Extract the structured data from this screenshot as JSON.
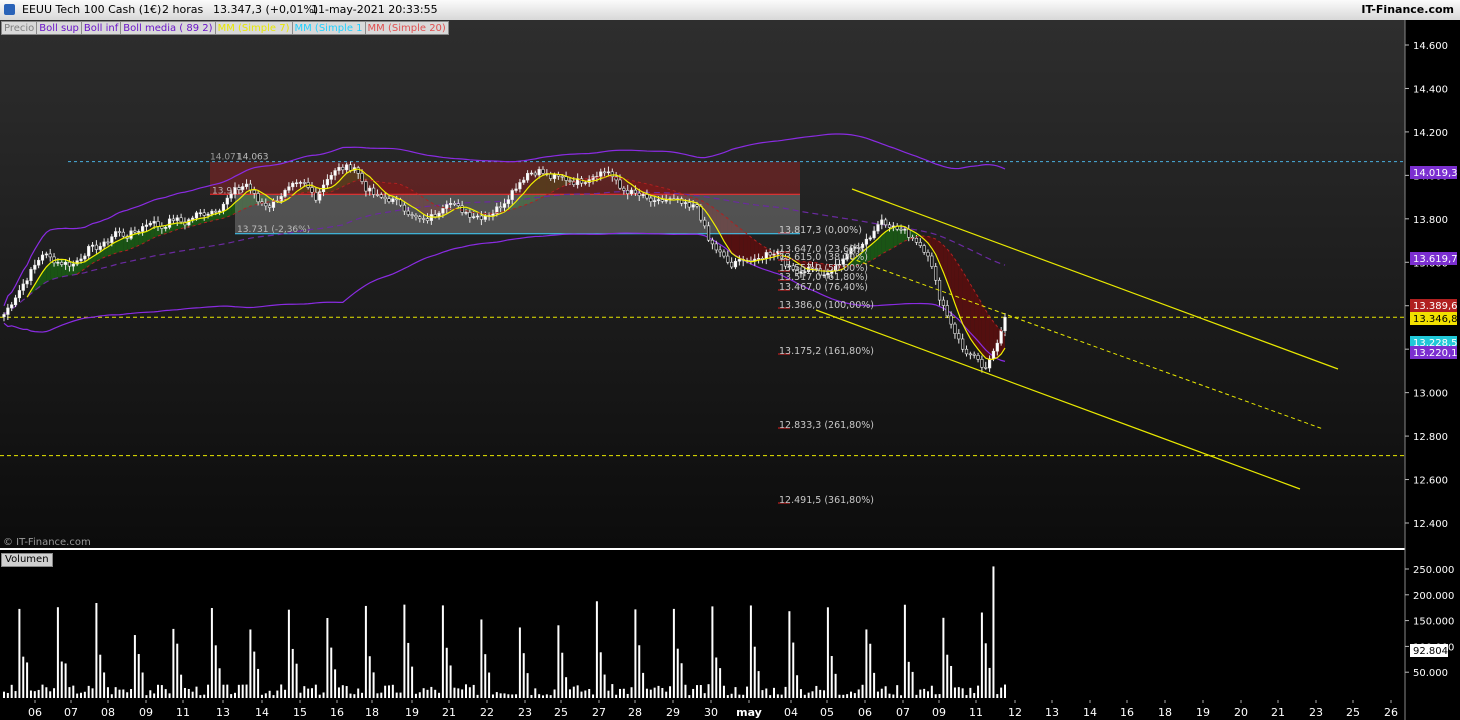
{
  "header": {
    "instrument": "EEUU Tech 100 Cash (1€)",
    "timeframe": "2 horas",
    "quote": "13.347,3 (+0,01%)",
    "datetime": "11-may-2021 20:33:55",
    "brand": "IT-Finance.com"
  },
  "legend": [
    {
      "label": "Precio",
      "color": "#808080"
    },
    {
      "label": "Boll sup",
      "color": "#6a14c8"
    },
    {
      "label": "Boll inf",
      "color": "#6a14c8"
    },
    {
      "label": "Boll media ( 89 2)",
      "color": "#6a14c8"
    },
    {
      "label": "MM (Simple 7)",
      "color": "#e8e800"
    },
    {
      "label": "MM (Simple 1",
      "color": "#20d0ff"
    },
    {
      "label": "MM (Simple 20)",
      "color": "#e05050"
    }
  ],
  "copyright": "© IT-Finance.com",
  "volume_label": "Volumen",
  "colors": {
    "up": "#ffffff",
    "down": "#ffffff",
    "boll": "#8a2be2",
    "ma_fast": "#f0f000",
    "ma_slow": "#d03030",
    "channel": "#e8e800",
    "level": "#e8e800",
    "range_box": "#7a1f1f"
  },
  "chart_data": [
    {
      "type": "candlestick",
      "title": "EEUU Tech 100 Cash (1€) 2 horas",
      "ylim": [
        12300,
        14750
      ],
      "y_ticks": [
        "14.600",
        "14.400",
        "14.200",
        "14.000",
        "13.800",
        "13.600",
        "13.400",
        "13.200",
        "13.000",
        "12.800",
        "12.600",
        "12.400"
      ],
      "x_ticks": [
        "06",
        "07",
        "08",
        "09",
        "11",
        "13",
        "14",
        "15",
        "16",
        "18",
        "19",
        "21",
        "22",
        "23",
        "25",
        "27",
        "28",
        "29",
        "30",
        "may",
        "04",
        "05",
        "06",
        "07",
        "09",
        "11",
        "12",
        "13",
        "14",
        "16",
        "18",
        "19",
        "20",
        "21",
        "23",
        "25",
        "26"
      ],
      "price_path": [
        [
          0,
          13360
        ],
        [
          5,
          13500
        ],
        [
          10,
          13640
        ],
        [
          14,
          13600
        ],
        [
          18,
          13590
        ],
        [
          22,
          13660
        ],
        [
          26,
          13680
        ],
        [
          29,
          13740
        ],
        [
          32,
          13720
        ],
        [
          35,
          13750
        ],
        [
          38,
          13790
        ],
        [
          41,
          13760
        ],
        [
          44,
          13800
        ],
        [
          47,
          13780
        ],
        [
          50,
          13820
        ],
        [
          53,
          13830
        ],
        [
          56,
          13850
        ],
        [
          60,
          13930
        ],
        [
          63,
          13960
        ],
        [
          66,
          13880
        ],
        [
          69,
          13860
        ],
        [
          72,
          13910
        ],
        [
          75,
          13950
        ],
        [
          78,
          13960
        ],
        [
          81,
          13900
        ],
        [
          84,
          13990
        ],
        [
          87,
          14030
        ],
        [
          91,
          14040
        ],
        [
          94,
          13940
        ],
        [
          97,
          13900
        ],
        [
          100,
          13890
        ],
        [
          103,
          13870
        ],
        [
          106,
          13810
        ],
        [
          109,
          13790
        ],
        [
          112,
          13820
        ],
        [
          115,
          13880
        ],
        [
          118,
          13850
        ],
        [
          121,
          13820
        ],
        [
          124,
          13810
        ],
        [
          127,
          13830
        ],
        [
          130,
          13880
        ],
        [
          133,
          13950
        ],
        [
          136,
          14010
        ],
        [
          139,
          14020
        ],
        [
          142,
          13990
        ],
        [
          145,
          13990
        ],
        [
          148,
          13970
        ],
        [
          151,
          13980
        ],
        [
          154,
          14010
        ],
        [
          157,
          14020
        ],
        [
          160,
          13940
        ],
        [
          163,
          13920
        ],
        [
          166,
          13900
        ],
        [
          169,
          13870
        ],
        [
          172,
          13890
        ],
        [
          175,
          13880
        ],
        [
          178,
          13850
        ],
        [
          180,
          13860
        ],
        [
          183,
          13700
        ],
        [
          186,
          13640
        ],
        [
          189,
          13580
        ],
        [
          192,
          13620
        ],
        [
          195,
          13600
        ],
        [
          198,
          13640
        ],
        [
          201,
          13650
        ],
        [
          204,
          13570
        ],
        [
          207,
          13560
        ],
        [
          210,
          13580
        ],
        [
          213,
          13530
        ],
        [
          216,
          13580
        ],
        [
          219,
          13640
        ],
        [
          222,
          13680
        ],
        [
          225,
          13720
        ],
        [
          228,
          13800
        ],
        [
          231,
          13760
        ],
        [
          234,
          13740
        ],
        [
          237,
          13700
        ],
        [
          240,
          13640
        ],
        [
          243,
          13440
        ],
        [
          246,
          13320
        ],
        [
          249,
          13200
        ],
        [
          252,
          13160
        ],
        [
          255,
          13100
        ],
        [
          258,
          13240
        ],
        [
          260,
          13347
        ]
      ],
      "bollinger": {
        "period": 89,
        "deviations": 2
      },
      "moving_averages": [
        7,
        20
      ],
      "horizontal_levels": [
        {
          "value": 14063,
          "label": "14.063",
          "style": "dashed"
        },
        {
          "value": 13346.8,
          "label": "13.346,8",
          "style": "dashed"
        },
        {
          "value": 12710,
          "label": "",
          "style": "dashed"
        }
      ],
      "range_box": {
        "top": 14063,
        "mid": 13913,
        "bottom": 13731,
        "labels": [
          "14.071",
          "14.063",
          "13.913",
          "13.731 (-2,36%)"
        ]
      },
      "fibonacci": [
        {
          "level": "13.817,3",
          "pct": "(0,00%)"
        },
        {
          "level": "13.647,0",
          "pct": "(23,60%)"
        },
        {
          "level": "13.615,0",
          "pct": "(38,20%)"
        },
        {
          "level": "13.557,0",
          "pct": "(50,00%)"
        },
        {
          "level": "13.517,0",
          "pct": "(61,80%)"
        },
        {
          "level": "13.467,0",
          "pct": "(76,40%)"
        },
        {
          "level": "13.386,0",
          "pct": "(100,00%)"
        },
        {
          "level": "13.175,2",
          "pct": "(161,80%)"
        },
        {
          "level": "12.833,3",
          "pct": "(261,80%)"
        },
        {
          "level": "12.491,5",
          "pct": "(361,80%)"
        }
      ],
      "price_tags": [
        {
          "text": "14.019,3",
          "bg": "#7b2fd0"
        },
        {
          "text": "13.619,7",
          "bg": "#7b2fd0"
        },
        {
          "text": "13.389,6",
          "bg": "#b02020"
        },
        {
          "text": "13.346,8",
          "bg": "#f2e000"
        },
        {
          "text": "13.228,5",
          "bg": "#20c8d8"
        },
        {
          "text": "13.220,1",
          "bg": "#7b2fd0"
        }
      ]
    },
    {
      "type": "bar",
      "title": "Volumen",
      "ylim": [
        0,
        280000
      ],
      "y_ticks": [
        "250.000",
        "200.000",
        "150.000",
        "100.000",
        "50.000"
      ],
      "last_value": "92.804"
    }
  ]
}
